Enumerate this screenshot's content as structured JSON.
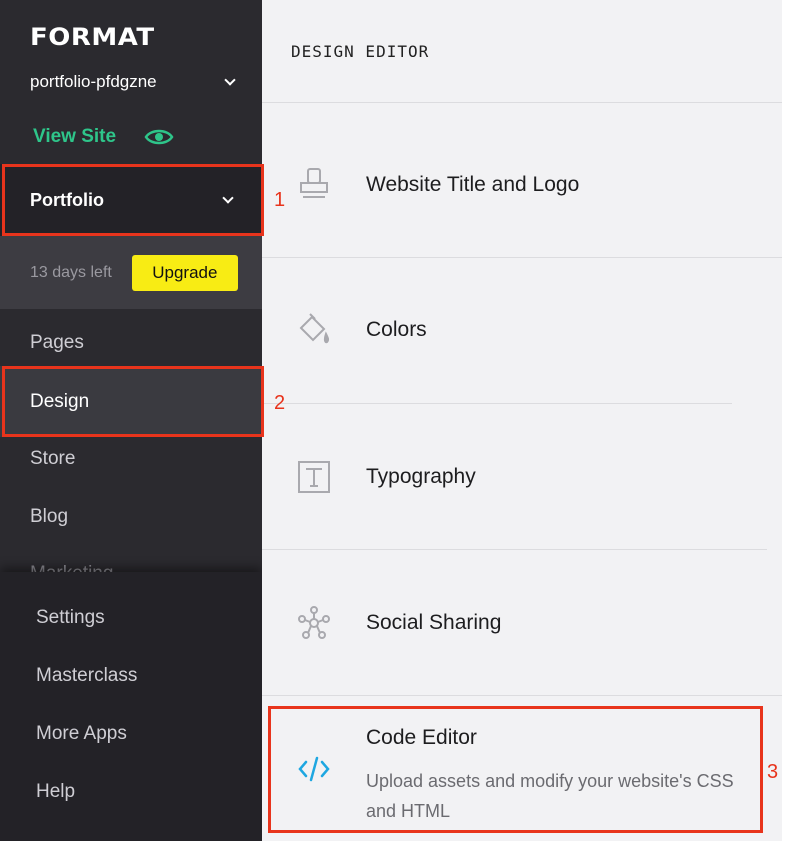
{
  "brand": {
    "logo": "FORMAT"
  },
  "site_selector": {
    "value": "portfolio-pfdgzne"
  },
  "view_site": {
    "label": "View Site"
  },
  "section_selector": {
    "value": "Portfolio"
  },
  "trial": {
    "text": "13 days left",
    "upgrade_label": "Upgrade"
  },
  "nav": {
    "pages": "Pages",
    "design": "Design",
    "store": "Store",
    "blog": "Blog",
    "marketing": "Marketing"
  },
  "bottom_nav": {
    "settings": "Settings",
    "masterclass": "Masterclass",
    "more_apps": "More Apps",
    "help": "Help"
  },
  "main": {
    "title": "DESIGN EDITOR",
    "items": [
      {
        "label": "Website Title and Logo",
        "icon": "stamp-icon"
      },
      {
        "label": "Colors",
        "icon": "paint-bucket-icon"
      },
      {
        "label": "Typography",
        "icon": "typography-icon"
      },
      {
        "label": "Social Sharing",
        "icon": "network-icon"
      },
      {
        "label": "Code Editor",
        "icon": "code-icon",
        "description": "Upload assets and modify your website's CSS and HTML"
      }
    ]
  },
  "annotations": {
    "one": "1",
    "two": "2",
    "three": "3"
  },
  "colors": {
    "sidebar_bg": "#2b2a2f",
    "accent_green": "#2ec58a",
    "upgrade_yellow": "#f8ec14",
    "highlight_red": "#e8341c",
    "code_icon_blue": "#1ea7e1"
  }
}
